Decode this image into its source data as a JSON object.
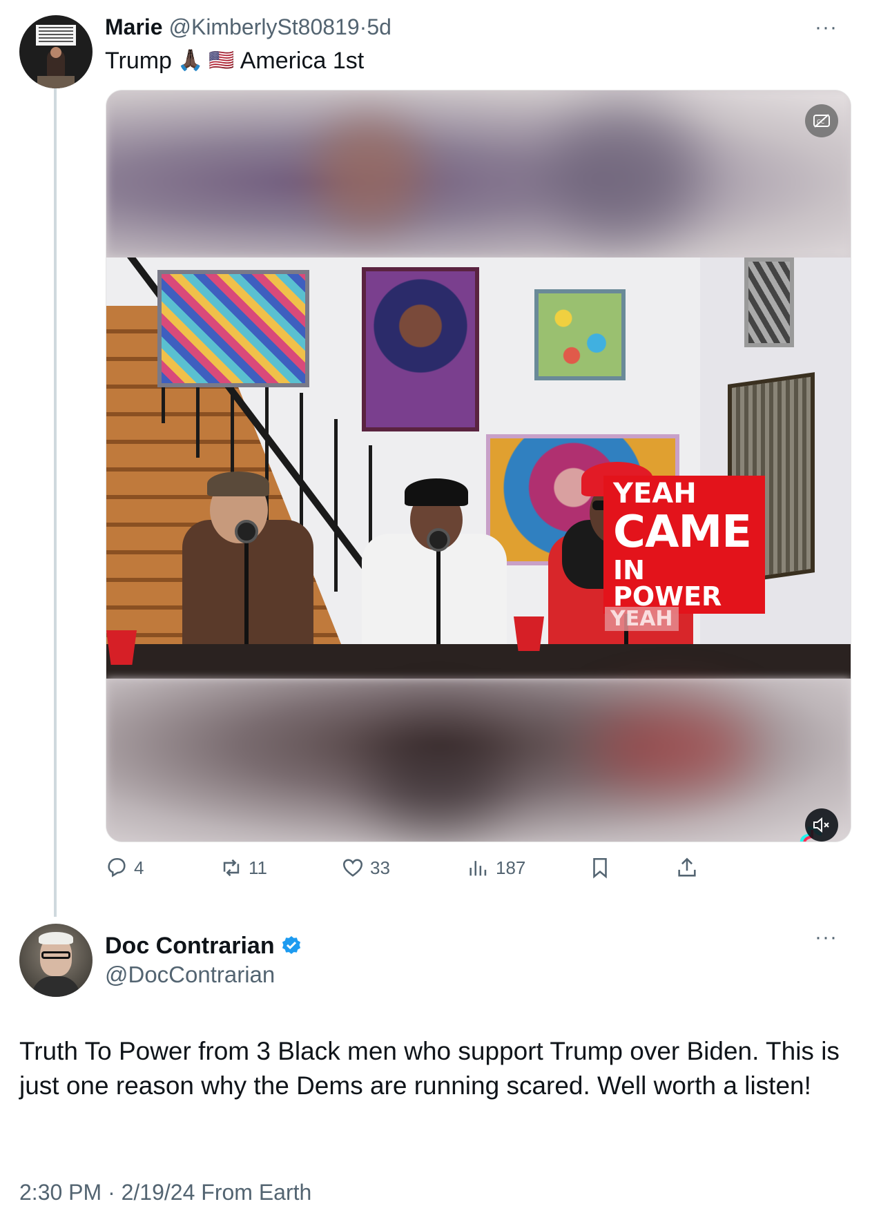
{
  "quoted_tweet": {
    "author_name": "Marie",
    "author_handle": "@KimberlySt80819",
    "separator": "·",
    "time_ago": "5d",
    "text_before": "Trump",
    "emoji_pray": "🙏🏿",
    "emoji_flag": "🇺🇸",
    "text_after": "America 1st",
    "more_label": "···",
    "media": {
      "caption_line1": "YEAH",
      "caption_line2": "CAME",
      "caption_line3": "IN POWER",
      "caption_ghost": "YEAH"
    },
    "stats": {
      "replies": "4",
      "reposts": "11",
      "likes": "33",
      "views": "187"
    }
  },
  "main_tweet": {
    "author_name": "Doc Contrarian",
    "author_handle": "@DocContrarian",
    "more_label": "···",
    "text": "Truth To Power from 3 Black men who support Trump over Biden. This is just one reason why the Dems are running scared. Well worth a listen!",
    "timestamp": "2:30 PM · 2/19/24 From Earth"
  },
  "colors": {
    "text_primary": "#0f1419",
    "text_secondary": "#536471",
    "verified_blue": "#1d9bf0",
    "thread_line": "#cfd9de",
    "caption_red": "#e3131b"
  },
  "icons": {
    "reply": "reply-icon",
    "repost": "repost-icon",
    "like": "like-icon",
    "views": "views-icon",
    "bookmark": "bookmark-icon",
    "share": "share-icon",
    "verified": "verified-badge-icon",
    "captions": "captions-off-icon",
    "mute": "mute-icon"
  }
}
